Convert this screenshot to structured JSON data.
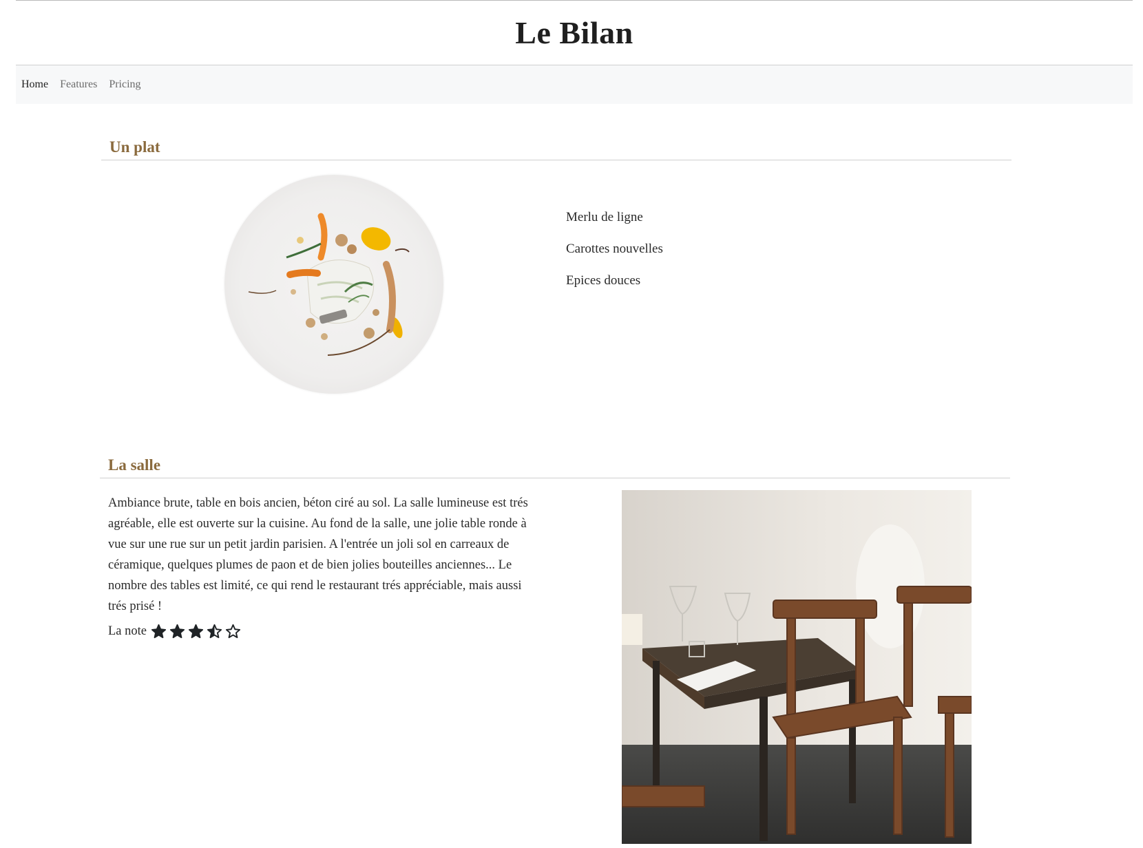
{
  "site": {
    "title": "Le Bilan"
  },
  "nav": {
    "items": [
      {
        "label": "Home",
        "active": true
      },
      {
        "label": "Features",
        "active": false
      },
      {
        "label": "Pricing",
        "active": false
      }
    ]
  },
  "plat": {
    "heading": "Un plat",
    "ingredients": [
      "Merlu de ligne",
      "Carottes nouvelles",
      "Epices douces"
    ]
  },
  "salle": {
    "heading": "La salle",
    "description": "Ambiance brute, table en bois ancien, béton ciré au sol. La salle lumineuse est trés agréable, elle est ouverte sur la cuisine. Au fond de la salle, une jolie table ronde à vue sur une rue sur un petit jardin parisien. A l'entrée un joli sol en carreaux de céramique, quelques plumes de paon et de bien jolies bouteilles anciennes... Le nombre des tables est limité, ce qui rend le restaurant trés appréciable, mais aussi trés prisé !",
    "rating_label": "La note",
    "rating": {
      "value": 3.5,
      "max": 5
    }
  },
  "colors": {
    "accent": "#8a6a3d",
    "text": "#212529",
    "nav_bg": "#f7f8f9"
  }
}
